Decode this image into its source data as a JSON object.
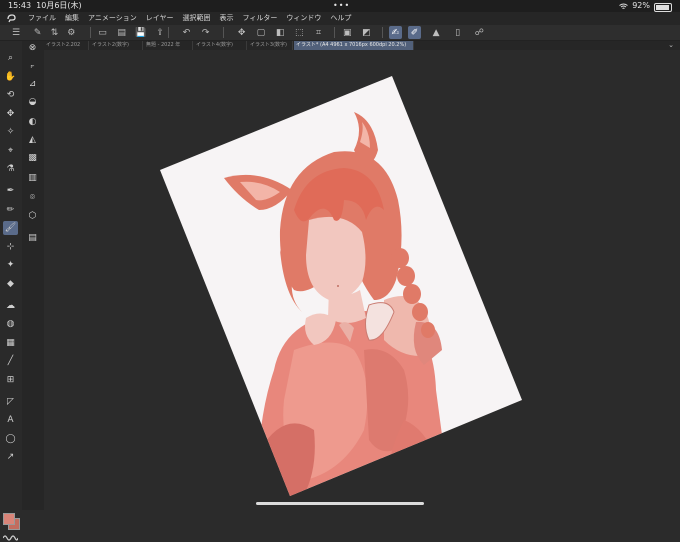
{
  "status_bar": {
    "time": "15:43",
    "date": "10月6日(木)",
    "dots": "•••",
    "battery": "92%",
    "battery_level": 0.92
  },
  "menu": {
    "items": [
      "ファイル",
      "編集",
      "アニメーション",
      "レイヤー",
      "選択範囲",
      "表示",
      "フィルター",
      "ウィンドウ",
      "ヘルプ"
    ]
  },
  "tabs": {
    "items": [
      {
        "label": "イラスト2.202"
      },
      {
        "label": "イラスト2(数字)"
      },
      {
        "label": "無題 - 2022 年"
      },
      {
        "label": "イラスト4(数字)"
      },
      {
        "label": "イラスト3(数字)"
      },
      {
        "label": "イラスト* (A4 4961 x 7016px 600dpi 20.2%)"
      }
    ]
  },
  "toolbar_icons": [
    "menu-icon",
    "new-icon",
    "updown-icon",
    "settings-icon",
    "new-file-icon",
    "open-file-icon",
    "save-icon",
    "export-icon",
    "undo-icon",
    "redo-icon",
    "transform-icon",
    "clear-icon",
    "fill-icon",
    "selection-icon",
    "crop-icon",
    "hide-selection-icon",
    "invert-icon",
    "pen-mode-icon",
    "brush-mode-icon",
    "ruler-icon",
    "smartphone-icon",
    "help-icon"
  ],
  "colors": {
    "accent": "#5a6b8a",
    "main_color": "#d98478",
    "sub_color": "#c26d5f",
    "canvas": "#f7f4f5",
    "hair": "#e07a67",
    "skin": "#f2c7bf"
  }
}
